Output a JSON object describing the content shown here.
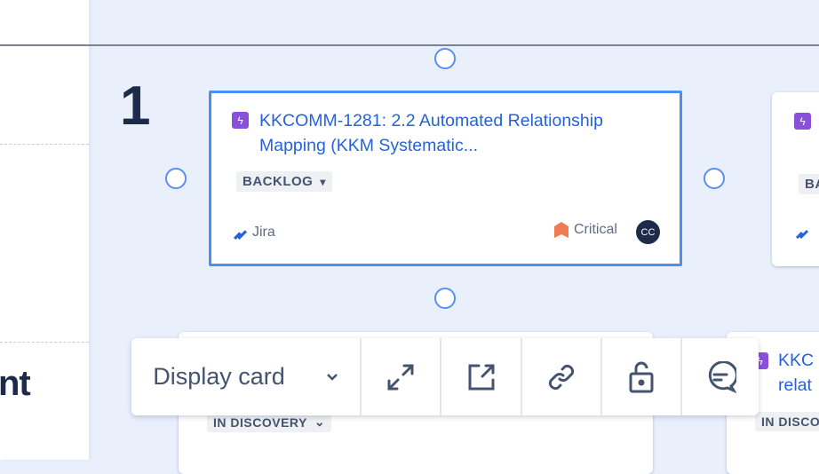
{
  "left_panel": {
    "partial_heading": "nt"
  },
  "row": {
    "number": "1"
  },
  "selected_card": {
    "key_title": "KKCOMM-1281: 2.2 Automated Relationship Mapping (KKM Systematic...",
    "status": "BACKLOG",
    "source": "Jira",
    "priority": "Critical",
    "assignee_initials": "CC"
  },
  "right_card": {
    "status": "BA"
  },
  "bottom_left_card": {
    "status": "IN DISCOVERY"
  },
  "bottom_right_card": {
    "title_line1": "KKC",
    "title_line2": "relat",
    "status": "IN DISCO"
  },
  "toolbar": {
    "display_select": "Display card"
  },
  "colors": {
    "accent": "#4C8DF6",
    "link": "#2563D9",
    "epic": "#8A50DA",
    "priority_critical": "#F07A52",
    "text_dark": "#1C2B4A"
  }
}
